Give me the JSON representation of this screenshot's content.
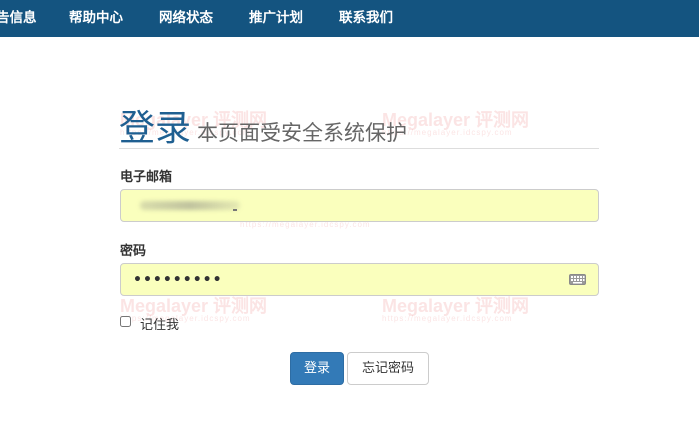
{
  "nav": {
    "items": [
      {
        "label": "告信息"
      },
      {
        "label": "帮助中心"
      },
      {
        "label": "网络状态"
      },
      {
        "label": "推广计划"
      },
      {
        "label": "联系我们"
      }
    ],
    "background": "#145480"
  },
  "watermark": {
    "title": "Megalayer 评测网",
    "url": "https://megalayer.idcspy.com"
  },
  "login": {
    "heading": "登录",
    "subheading": "本页面受安全系统保护",
    "email_label": "电子邮箱",
    "password_label": "密码",
    "password_value": "•••••••••",
    "remember_label": "记住我",
    "submit_label": "登录",
    "forgot_label": "忘记密码",
    "primary_color": "#337ab7",
    "autofill_color": "#faffbd"
  }
}
